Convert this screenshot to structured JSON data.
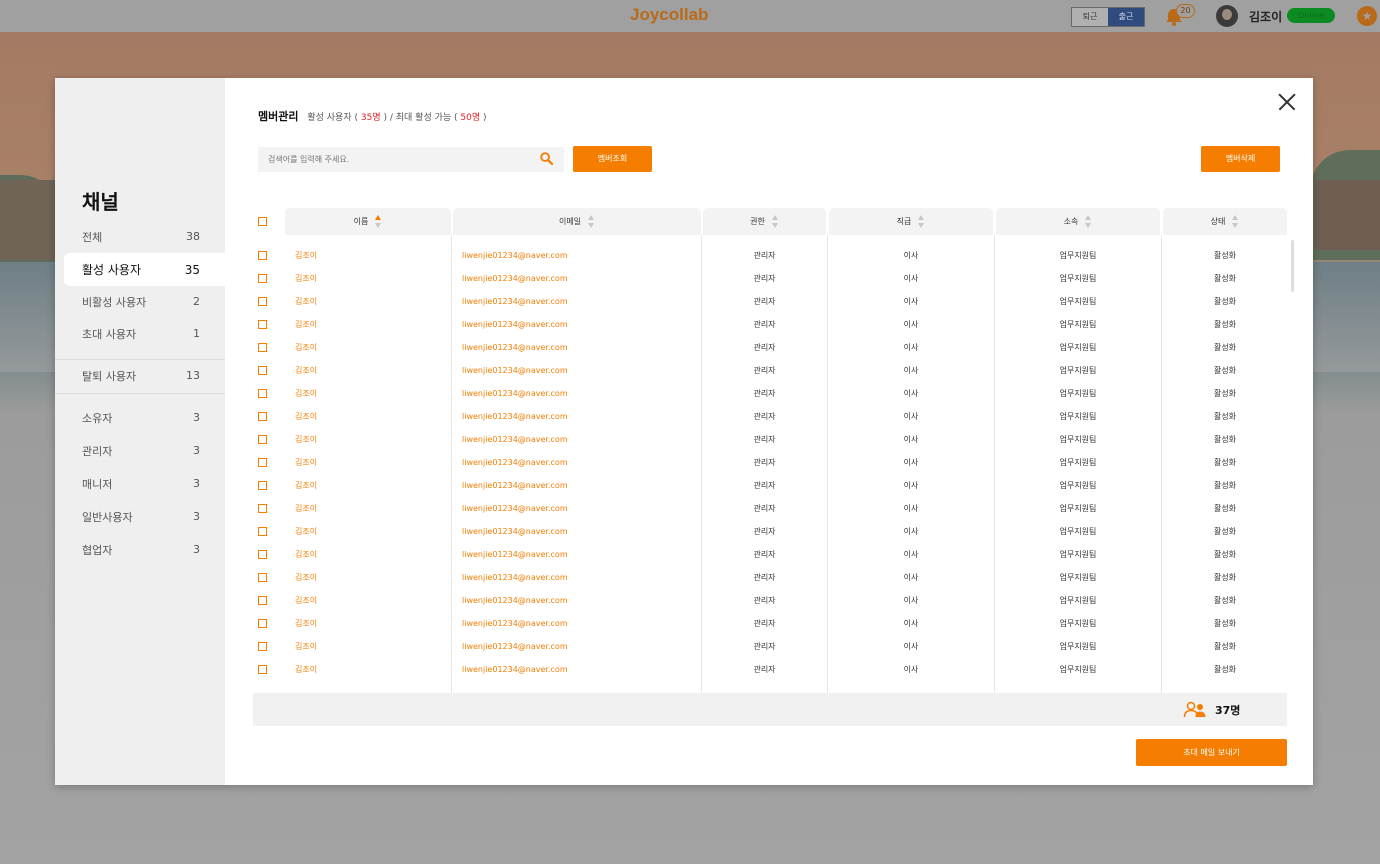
{
  "topbar": {
    "logo": "Joycollab",
    "toggle": [
      "퇴근",
      "출근"
    ],
    "bell_count": "20",
    "user_name": "김조이",
    "status": "Online"
  },
  "sidebar": {
    "title": "채널",
    "groups": [
      [
        {
          "label": "전체",
          "count": "38"
        },
        {
          "label": "활성 사용자",
          "count": "35",
          "active": true
        },
        {
          "label": "비활성 사용자",
          "count": "2"
        },
        {
          "label": "초대 사용자",
          "count": "1"
        }
      ],
      [
        {
          "label": "탈퇴 사용자",
          "count": "13"
        }
      ],
      [
        {
          "label": "소유자",
          "count": "3"
        },
        {
          "label": "관리자",
          "count": "3"
        },
        {
          "label": "매니저",
          "count": "3"
        },
        {
          "label": "일반사용자",
          "count": "3"
        },
        {
          "label": "협업자",
          "count": "3"
        }
      ]
    ]
  },
  "header": {
    "title": "멤버관리",
    "active_label": "활성 사용자 (",
    "active_count": "35명",
    "max_label": ") / 최대 활성 가능 (",
    "max_count": "50명",
    "tail": ")"
  },
  "search": {
    "placeholder": "검색어를 입력해 주세요."
  },
  "buttons": {
    "search": "멤버조회",
    "delete": "멤버삭제",
    "invite": "초대 메일 보내기"
  },
  "columns": [
    "이름",
    "이메일",
    "권한",
    "직급",
    "소속",
    "상태"
  ],
  "rows": [
    {
      "name": "김조이",
      "email": "liwenjie01234@naver.com",
      "role": "관리자",
      "rank": "이사",
      "dept": "업무지원팀",
      "status": "활성화"
    },
    {
      "name": "김조이",
      "email": "liwenjie01234@naver.com",
      "role": "관리자",
      "rank": "이사",
      "dept": "업무지원팀",
      "status": "활성화"
    },
    {
      "name": "김조이",
      "email": "liwenjie01234@naver.com",
      "role": "관리자",
      "rank": "이사",
      "dept": "업무지원팀",
      "status": "활성화"
    },
    {
      "name": "김조이",
      "email": "liwenjie01234@naver.com",
      "role": "관리자",
      "rank": "이사",
      "dept": "업무지원팀",
      "status": "활성화"
    },
    {
      "name": "김조이",
      "email": "liwenjie01234@naver.com",
      "role": "관리자",
      "rank": "이사",
      "dept": "업무지원팀",
      "status": "활성화"
    },
    {
      "name": "김조이",
      "email": "liwenjie01234@naver.com",
      "role": "관리자",
      "rank": "이사",
      "dept": "업무지원팀",
      "status": "활성화"
    },
    {
      "name": "김조이",
      "email": "liwenjie01234@naver.com",
      "role": "관리자",
      "rank": "이사",
      "dept": "업무지원팀",
      "status": "활성화"
    },
    {
      "name": "김조이",
      "email": "liwenjie01234@naver.com",
      "role": "관리자",
      "rank": "이사",
      "dept": "업무지원팀",
      "status": "활성화"
    },
    {
      "name": "김조이",
      "email": "liwenjie01234@naver.com",
      "role": "관리자",
      "rank": "이사",
      "dept": "업무지원팀",
      "status": "활성화"
    },
    {
      "name": "김조이",
      "email": "liwenjie01234@naver.com",
      "role": "관리자",
      "rank": "이사",
      "dept": "업무지원팀",
      "status": "활성화"
    },
    {
      "name": "김조이",
      "email": "liwenjie01234@naver.com",
      "role": "관리자",
      "rank": "이사",
      "dept": "업무지원팀",
      "status": "활성화"
    },
    {
      "name": "김조이",
      "email": "liwenjie01234@naver.com",
      "role": "관리자",
      "rank": "이사",
      "dept": "업무지원팀",
      "status": "활성화"
    },
    {
      "name": "김조이",
      "email": "liwenjie01234@naver.com",
      "role": "관리자",
      "rank": "이사",
      "dept": "업무지원팀",
      "status": "활성화"
    },
    {
      "name": "김조이",
      "email": "liwenjie01234@naver.com",
      "role": "관리자",
      "rank": "이사",
      "dept": "업무지원팀",
      "status": "활성화"
    },
    {
      "name": "김조이",
      "email": "liwenjie01234@naver.com",
      "role": "관리자",
      "rank": "이사",
      "dept": "업무지원팀",
      "status": "활성화"
    },
    {
      "name": "김조이",
      "email": "liwenjie01234@naver.com",
      "role": "관리자",
      "rank": "이사",
      "dept": "업무지원팀",
      "status": "활성화"
    },
    {
      "name": "김조이",
      "email": "liwenjie01234@naver.com",
      "role": "관리자",
      "rank": "이사",
      "dept": "업무지원팀",
      "status": "활성화"
    },
    {
      "name": "김조이",
      "email": "liwenjie01234@naver.com",
      "role": "관리자",
      "rank": "이사",
      "dept": "업무지원팀",
      "status": "활성화"
    },
    {
      "name": "김조이",
      "email": "liwenjie01234@naver.com",
      "role": "관리자",
      "rank": "이사",
      "dept": "업무지원팀",
      "status": "활성화"
    }
  ],
  "footer": {
    "total": "37명"
  },
  "colors": {
    "accent": "#f57d00",
    "count_red": "#dd2222"
  }
}
